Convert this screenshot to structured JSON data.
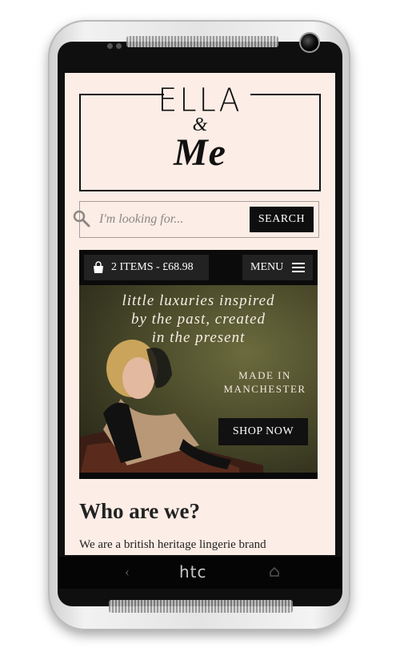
{
  "logo": {
    "line1": "ELLA",
    "amp": "&",
    "line2": "Me"
  },
  "search": {
    "placeholder": "I'm looking for...",
    "button_label": "SEARCH"
  },
  "cart": {
    "label": "2 ITEMS - £68.98"
  },
  "menu": {
    "label": "MENU"
  },
  "hero": {
    "tagline_lines": [
      "little luxuries inspired",
      "by the past, created",
      "in the present"
    ],
    "made_in_lines": [
      "MADE IN",
      "MANCHESTER"
    ],
    "shop_button": "SHOP NOW"
  },
  "content": {
    "heading": "Who are we?",
    "intro": "We are a british heritage lingerie brand"
  },
  "device": {
    "brand": "htc",
    "back_glyph": "‹",
    "home_glyph": "⌂"
  },
  "icons": {
    "search": "search-icon",
    "cart": "shopping-bag-icon",
    "menu": "hamburger-icon"
  },
  "colors": {
    "screen_bg": "#fcede6",
    "dark": "#0e0e0e"
  }
}
